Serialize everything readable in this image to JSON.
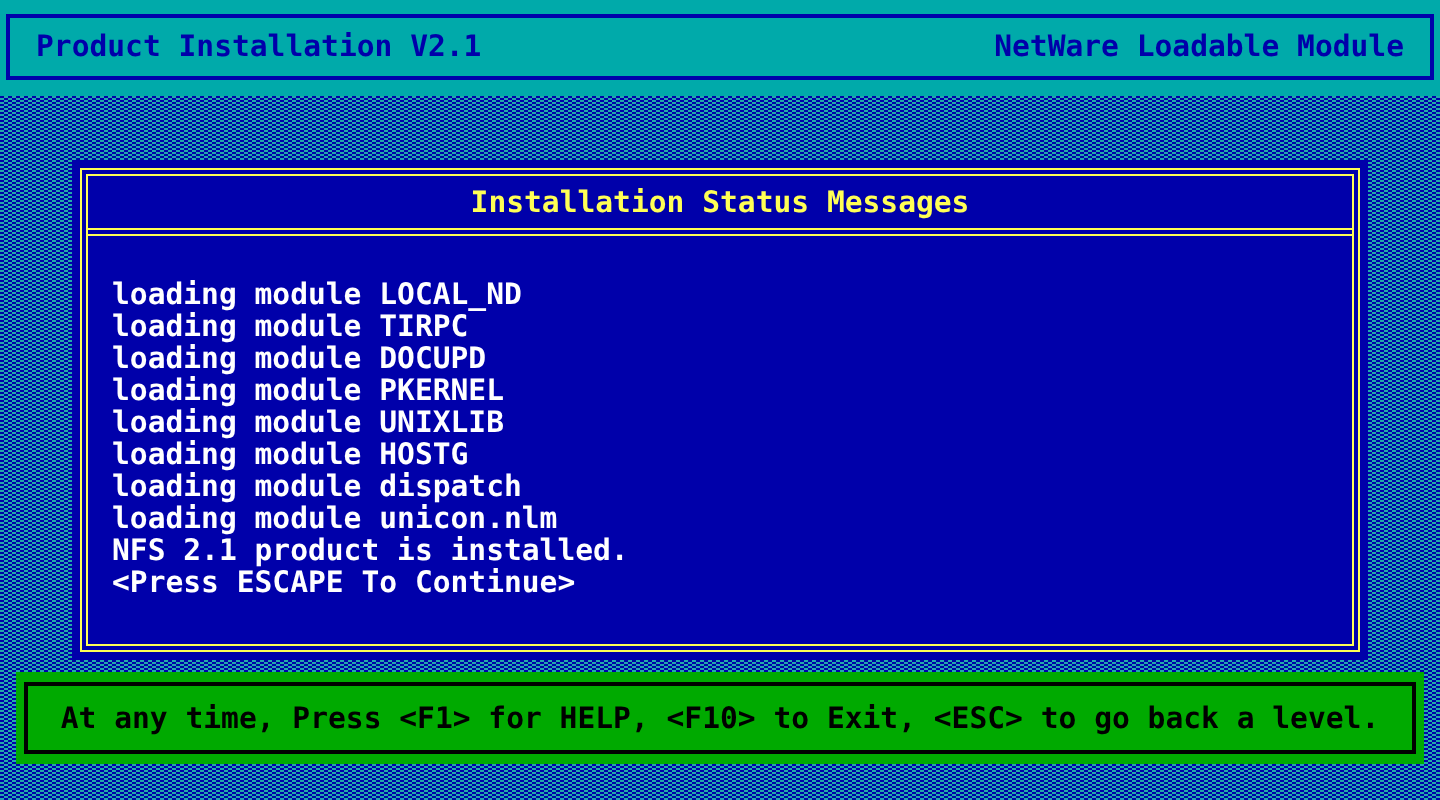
{
  "header": {
    "title": "Product Installation  V2.1",
    "subtitle": "NetWare Loadable Module"
  },
  "dialog": {
    "title": "Installation Status Messages",
    "messages": [
      "loading module LOCAL_ND",
      "loading module TIRPC",
      "loading module DOCUPD",
      "loading module PKERNEL",
      "loading module UNIXLIB",
      "loading module HOSTG",
      "loading module dispatch",
      "loading module unicon.nlm",
      "NFS 2.1 product is installed.",
      "<Press ESCAPE To Continue>"
    ]
  },
  "footer": {
    "help": "At any time, Press <F1> for HELP, <F10> to Exit, <ESC> to go back a level."
  }
}
